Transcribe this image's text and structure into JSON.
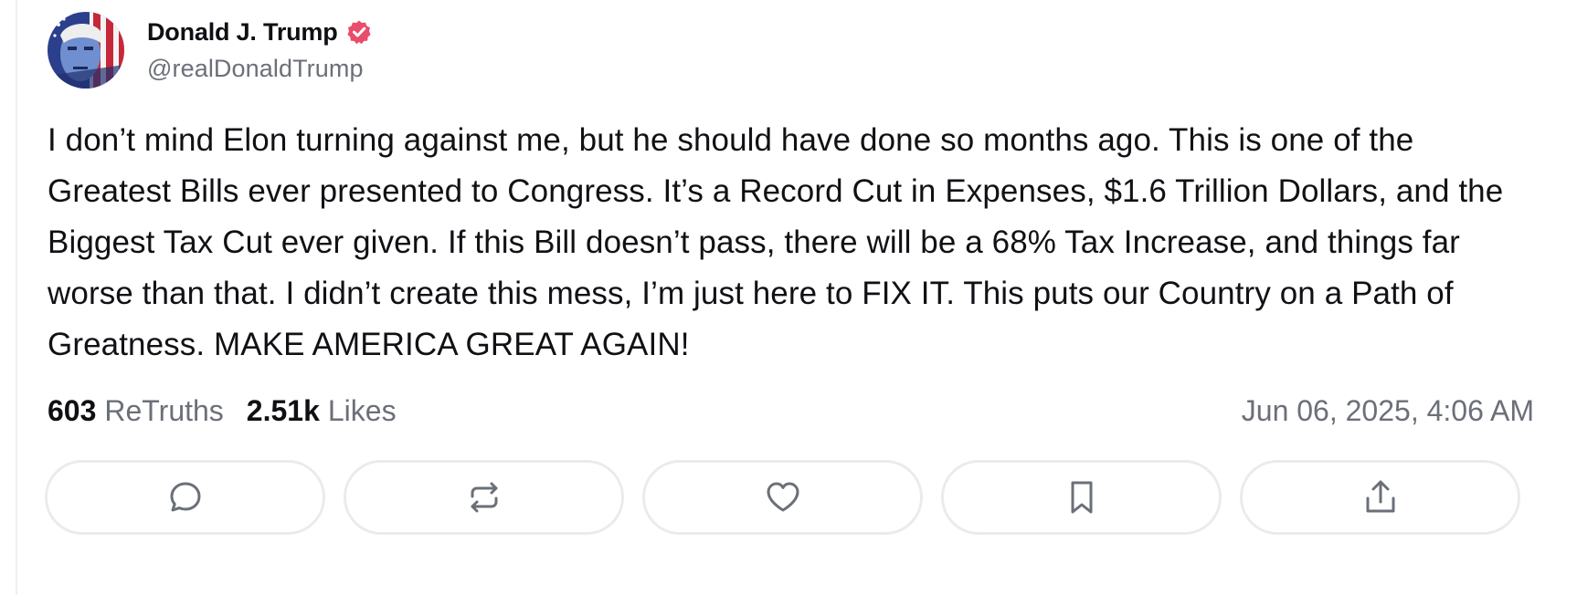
{
  "post": {
    "author": {
      "name": "Donald J. Trump",
      "handle": "@realDonaldTrump",
      "verified_color": "#ea4d6b"
    },
    "text": "I don’t mind Elon turning against me, but he should have done so months ago. This is one of the Greatest Bills ever presented to Congress. It’s a Record Cut in Expenses, $1.6 Trillion Dollars, and the Biggest Tax Cut ever given. If this Bill doesn’t pass, there will be a 68% Tax Increase, and things far worse than that. I didn’t create this mess, I’m just here to FIX IT. This puts our Country on a Path of Greatness. MAKE AMERICA GREAT AGAIN!",
    "stats": {
      "retruths_count": "603",
      "retruths_label": "ReTruths",
      "likes_count": "2.51k",
      "likes_label": "Likes"
    },
    "timestamp": "Jun 06, 2025, 4:06 AM"
  },
  "actions": [
    {
      "name": "reply",
      "icon": "comment-icon"
    },
    {
      "name": "retruth",
      "icon": "repost-icon"
    },
    {
      "name": "like",
      "icon": "heart-icon"
    },
    {
      "name": "bookmark",
      "icon": "bookmark-icon"
    },
    {
      "name": "share",
      "icon": "share-icon"
    }
  ],
  "colors": {
    "icon": "#6b6f78",
    "muted_text": "#6b6f78",
    "button_border": "#e9ebee"
  }
}
